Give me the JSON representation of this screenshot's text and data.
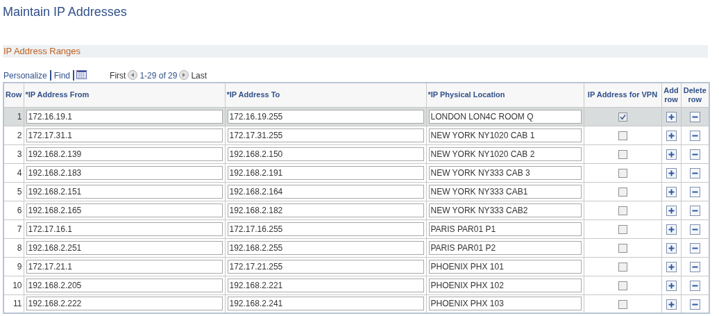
{
  "page_title": "Maintain IP Addresses",
  "section_title": "IP Address Ranges",
  "grid_toolbar": {
    "links": [
      "Personalize",
      "Find"
    ],
    "first": "First",
    "range": "1-29 of 29",
    "last": "Last"
  },
  "table": {
    "columns": [
      "Row",
      "*IP Address From",
      "*IP Address To",
      "*IP Physical Location",
      "IP Address for VPN",
      "Add row",
      "Delete row"
    ],
    "rows": [
      {
        "row": "1",
        "from": "172.16.19.1",
        "to": "172.16.19.255",
        "location": "LONDON LON4C ROOM Q",
        "vpn": true,
        "selected": true
      },
      {
        "row": "2",
        "from": "172.17.31.1",
        "to": "172.17.31.255",
        "location": "NEW YORK NY1020 CAB 1",
        "vpn": false,
        "selected": false
      },
      {
        "row": "3",
        "from": "192.168.2.139",
        "to": "192.168.2.150",
        "location": "NEW YORK NY1020 CAB 2",
        "vpn": false,
        "selected": false
      },
      {
        "row": "4",
        "from": "192.168.2.183",
        "to": "192.168.2.191",
        "location": "NEW YORK NY333 CAB 3",
        "vpn": false,
        "selected": false
      },
      {
        "row": "5",
        "from": "192.168.2.151",
        "to": "192.168.2.164",
        "location": "NEW YORK NY333 CAB1",
        "vpn": false,
        "selected": false
      },
      {
        "row": "6",
        "from": "192.168.2.165",
        "to": "192.168.2.182",
        "location": "NEW YORK NY333 CAB2",
        "vpn": false,
        "selected": false
      },
      {
        "row": "7",
        "from": "172.17.16.1",
        "to": "172.17.16.255",
        "location": "PARIS PAR01 P1",
        "vpn": false,
        "selected": false
      },
      {
        "row": "8",
        "from": "192.168.2.251",
        "to": "192.168.2.255",
        "location": "PARIS PAR01 P2",
        "vpn": false,
        "selected": false
      },
      {
        "row": "9",
        "from": "172.17.21.1",
        "to": "172.17.21.255",
        "location": "PHOENIX PHX 101",
        "vpn": false,
        "selected": false
      },
      {
        "row": "10",
        "from": "192.168.2.205",
        "to": "192.168.2.221",
        "location": "PHOENIX PHX 102",
        "vpn": false,
        "selected": false
      },
      {
        "row": "11",
        "from": "192.168.2.222",
        "to": "192.168.2.241",
        "location": "PHOENIX PHX 103",
        "vpn": false,
        "selected": false
      }
    ]
  }
}
